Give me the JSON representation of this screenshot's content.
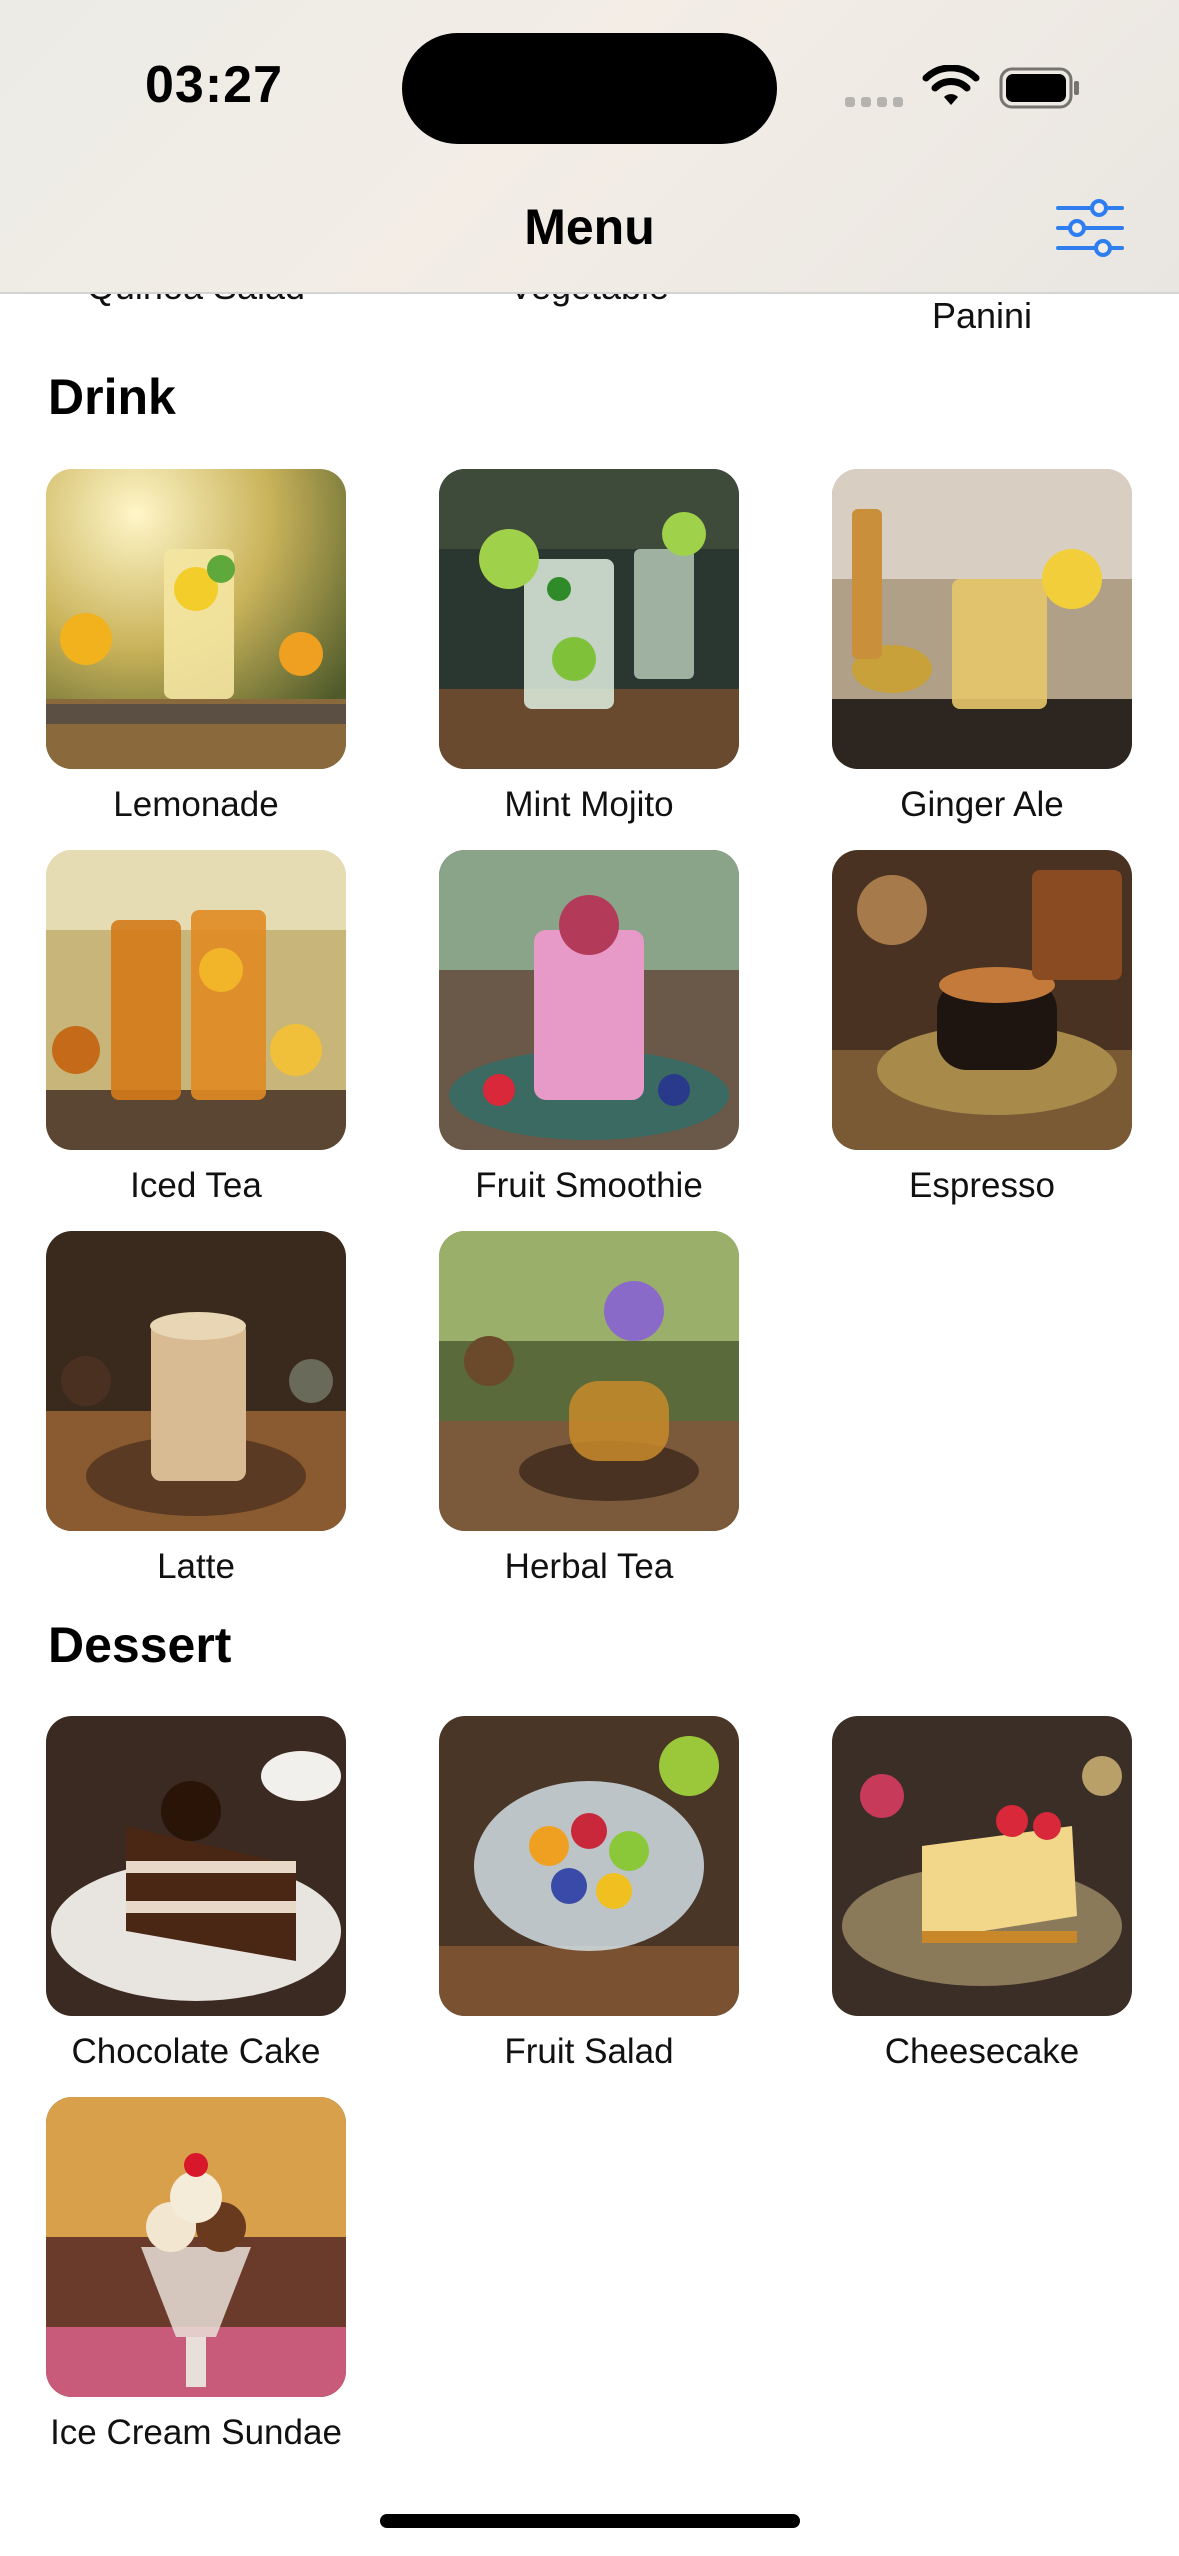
{
  "status": {
    "time": "03:27"
  },
  "header": {
    "title": "Menu",
    "filter_icon": "sliders-icon"
  },
  "partial_row": [
    "Quinoa Salad",
    "Vegetable Lasagna",
    "Panini"
  ],
  "sections": [
    {
      "title": "Drink",
      "items": [
        "Lemonade",
        "Mint Mojito",
        "Ginger Ale",
        "Iced Tea",
        "Fruit Smoothie",
        "Espresso",
        "Latte",
        "Herbal Tea"
      ]
    },
    {
      "title": "Dessert",
      "items": [
        "Chocolate Cake",
        "Fruit Salad",
        "Cheesecake",
        "Ice Cream Sundae"
      ]
    }
  ],
  "colors": {
    "accent": "#2f7ef0"
  }
}
